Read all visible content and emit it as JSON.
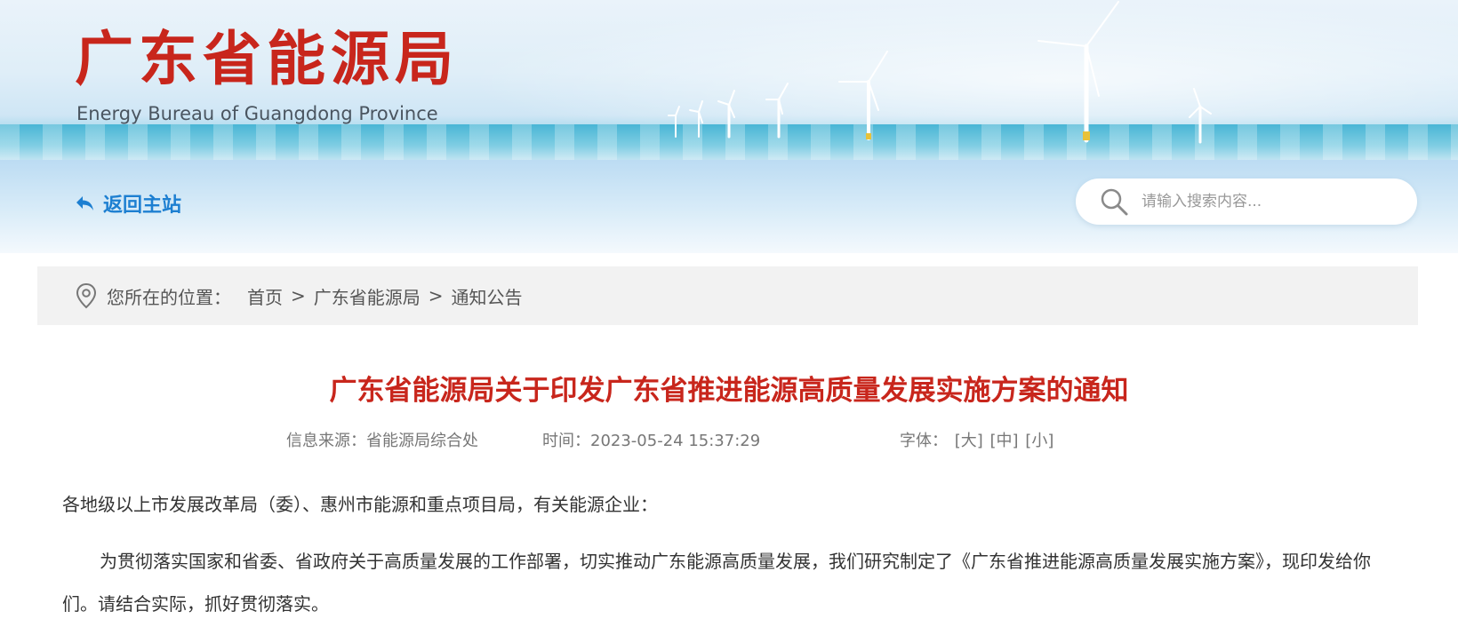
{
  "header": {
    "logo_cn": "广东省能源局",
    "logo_en": "Energy Bureau of Guangdong Province"
  },
  "nav": {
    "back_label": "返回主站",
    "back_icon": "reply-arrow-icon",
    "search_placeholder": "请输入搜索内容...",
    "search_value": "",
    "search_icon": "search-icon"
  },
  "breadcrumb": {
    "label": "您所在的位置：",
    "items": [
      "首页",
      "广东省能源局",
      "通知公告"
    ],
    "separator": ">",
    "icon": "location-pin-icon"
  },
  "article": {
    "title": "广东省能源局关于印发广东省推进能源高质量发展实施方案的通知",
    "source_label": "信息来源：",
    "source_value": "省能源局综合处",
    "time_label": "时间：",
    "time_value": "2023-05-24 15:37:29",
    "font_label": "字体：",
    "font_options": [
      "[大]",
      "[中]",
      "[小]"
    ],
    "salutation": "各地级以上市发展改革局（委）、惠州市能源和重点项目局，有关能源企业：",
    "paragraph": "为贯彻落实国家和省委、省政府关于高质量发展的工作部署，切实推动广东能源高质量发展，我们研究制定了《广东省推进能源高质量发展实施方案》，现印发给你们。请结合实际，抓好贯彻落实。"
  },
  "colors": {
    "brand_red": "#c8261c",
    "link_blue": "#1d7fd1",
    "breadcrumb_bg": "#f2f2f2"
  }
}
